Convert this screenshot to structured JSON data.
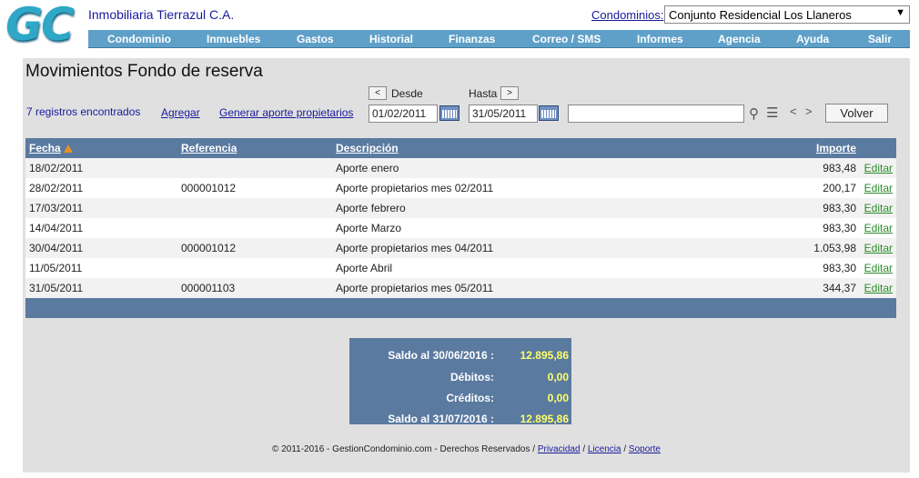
{
  "brand": {
    "logo_text": "GC",
    "company": "Inmobiliaria Tierrazul C.A."
  },
  "condo": {
    "label": "Condominios:",
    "selected": "Conjunto Residencial Los Llaneros"
  },
  "nav": {
    "items": [
      {
        "label": "Condominio"
      },
      {
        "label": "Inmuebles"
      },
      {
        "label": "Gastos"
      },
      {
        "label": "Historial"
      },
      {
        "label": "Finanzas"
      },
      {
        "label": "Correo / SMS"
      },
      {
        "label": "Informes"
      },
      {
        "label": "Agencia"
      },
      {
        "label": "Ayuda"
      },
      {
        "label": "Salir"
      }
    ]
  },
  "page": {
    "title": "Movimientos Fondo de reserva",
    "records_found": "7 registros encontrados",
    "add_link": "Agregar",
    "generate_link": "Generar aporte propietarios",
    "desde_label": "Desde",
    "hasta_label": "Hasta",
    "prev_glyph": "<",
    "next_glyph": ">",
    "desde_value": "01/02/2011",
    "hasta_value": "31/05/2011",
    "search_value": "",
    "volver_label": "Volver"
  },
  "table": {
    "headers": {
      "fecha": "Fecha",
      "referencia": "Referencia",
      "descripcion": "Descripción",
      "importe": "Importe"
    },
    "edit_label": "Editar",
    "rows": [
      {
        "fecha": "18/02/2011",
        "referencia": "",
        "descripcion": "Aporte enero",
        "importe": "983,48"
      },
      {
        "fecha": "28/02/2011",
        "referencia": "000001012",
        "descripcion": "Aporte propietarios mes 02/2011",
        "importe": "200,17"
      },
      {
        "fecha": "17/03/2011",
        "referencia": "",
        "descripcion": "Aporte febrero",
        "importe": "983,30"
      },
      {
        "fecha": "14/04/2011",
        "referencia": "",
        "descripcion": "Aporte Marzo",
        "importe": "983,30"
      },
      {
        "fecha": "30/04/2011",
        "referencia": "000001012",
        "descripcion": "Aporte propietarios mes 04/2011",
        "importe": "1.053,98"
      },
      {
        "fecha": "11/05/2011",
        "referencia": "",
        "descripcion": "Aporte Abril",
        "importe": "983,30"
      },
      {
        "fecha": "31/05/2011",
        "referencia": "000001103",
        "descripcion": "Aporte propietarios mes 05/2011",
        "importe": "344,37"
      }
    ]
  },
  "totals": {
    "saldo_inicial_label": "Saldo al 30/06/2016 :",
    "saldo_inicial": "12.895,86",
    "debitos_label": "Débitos:",
    "debitos": "0,00",
    "creditos_label": "Créditos:",
    "creditos": "0,00",
    "saldo_final_label": "Saldo al 31/07/2016 :",
    "saldo_final": "12.895,86"
  },
  "footer": {
    "copyright": "© 2011-2016 - GestionCondominio.com - Derechos Reservados /",
    "privacy": "Privacidad",
    "license": "Licencia",
    "support": "Soporte",
    "sep": "/"
  },
  "colors": {
    "header_blue": "#5a7aa0",
    "nav_blue": "#5fa0c8",
    "link_blue": "#1a1a9c",
    "edit_green": "#2a8a2a",
    "total_yellow": "#ffff66"
  }
}
